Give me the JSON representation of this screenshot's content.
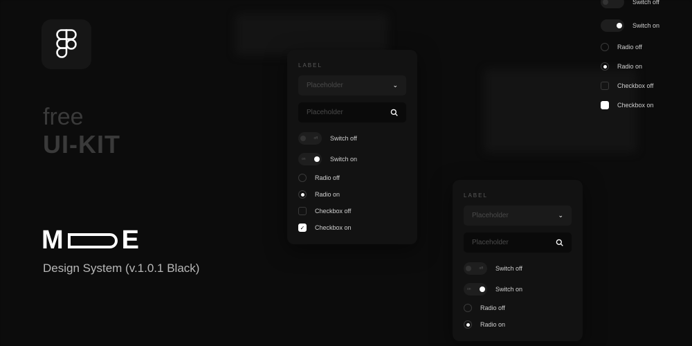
{
  "branding": {
    "free": "free",
    "uikit": "UI-KIT",
    "subtitle": "Design System (v.1.0.1 Black)"
  },
  "form": {
    "label": "LABEL",
    "select_placeholder": "Placeholder",
    "search_placeholder": "Placeholder"
  },
  "controls": {
    "switch_off": "Switch off",
    "switch_on": "Switch on",
    "radio_off": "Radio off",
    "radio_on": "Radio on",
    "checkbox_off": "Checkbox off",
    "checkbox_on": "Checkbox on",
    "off_tiny": "off",
    "on_tiny": "on"
  }
}
